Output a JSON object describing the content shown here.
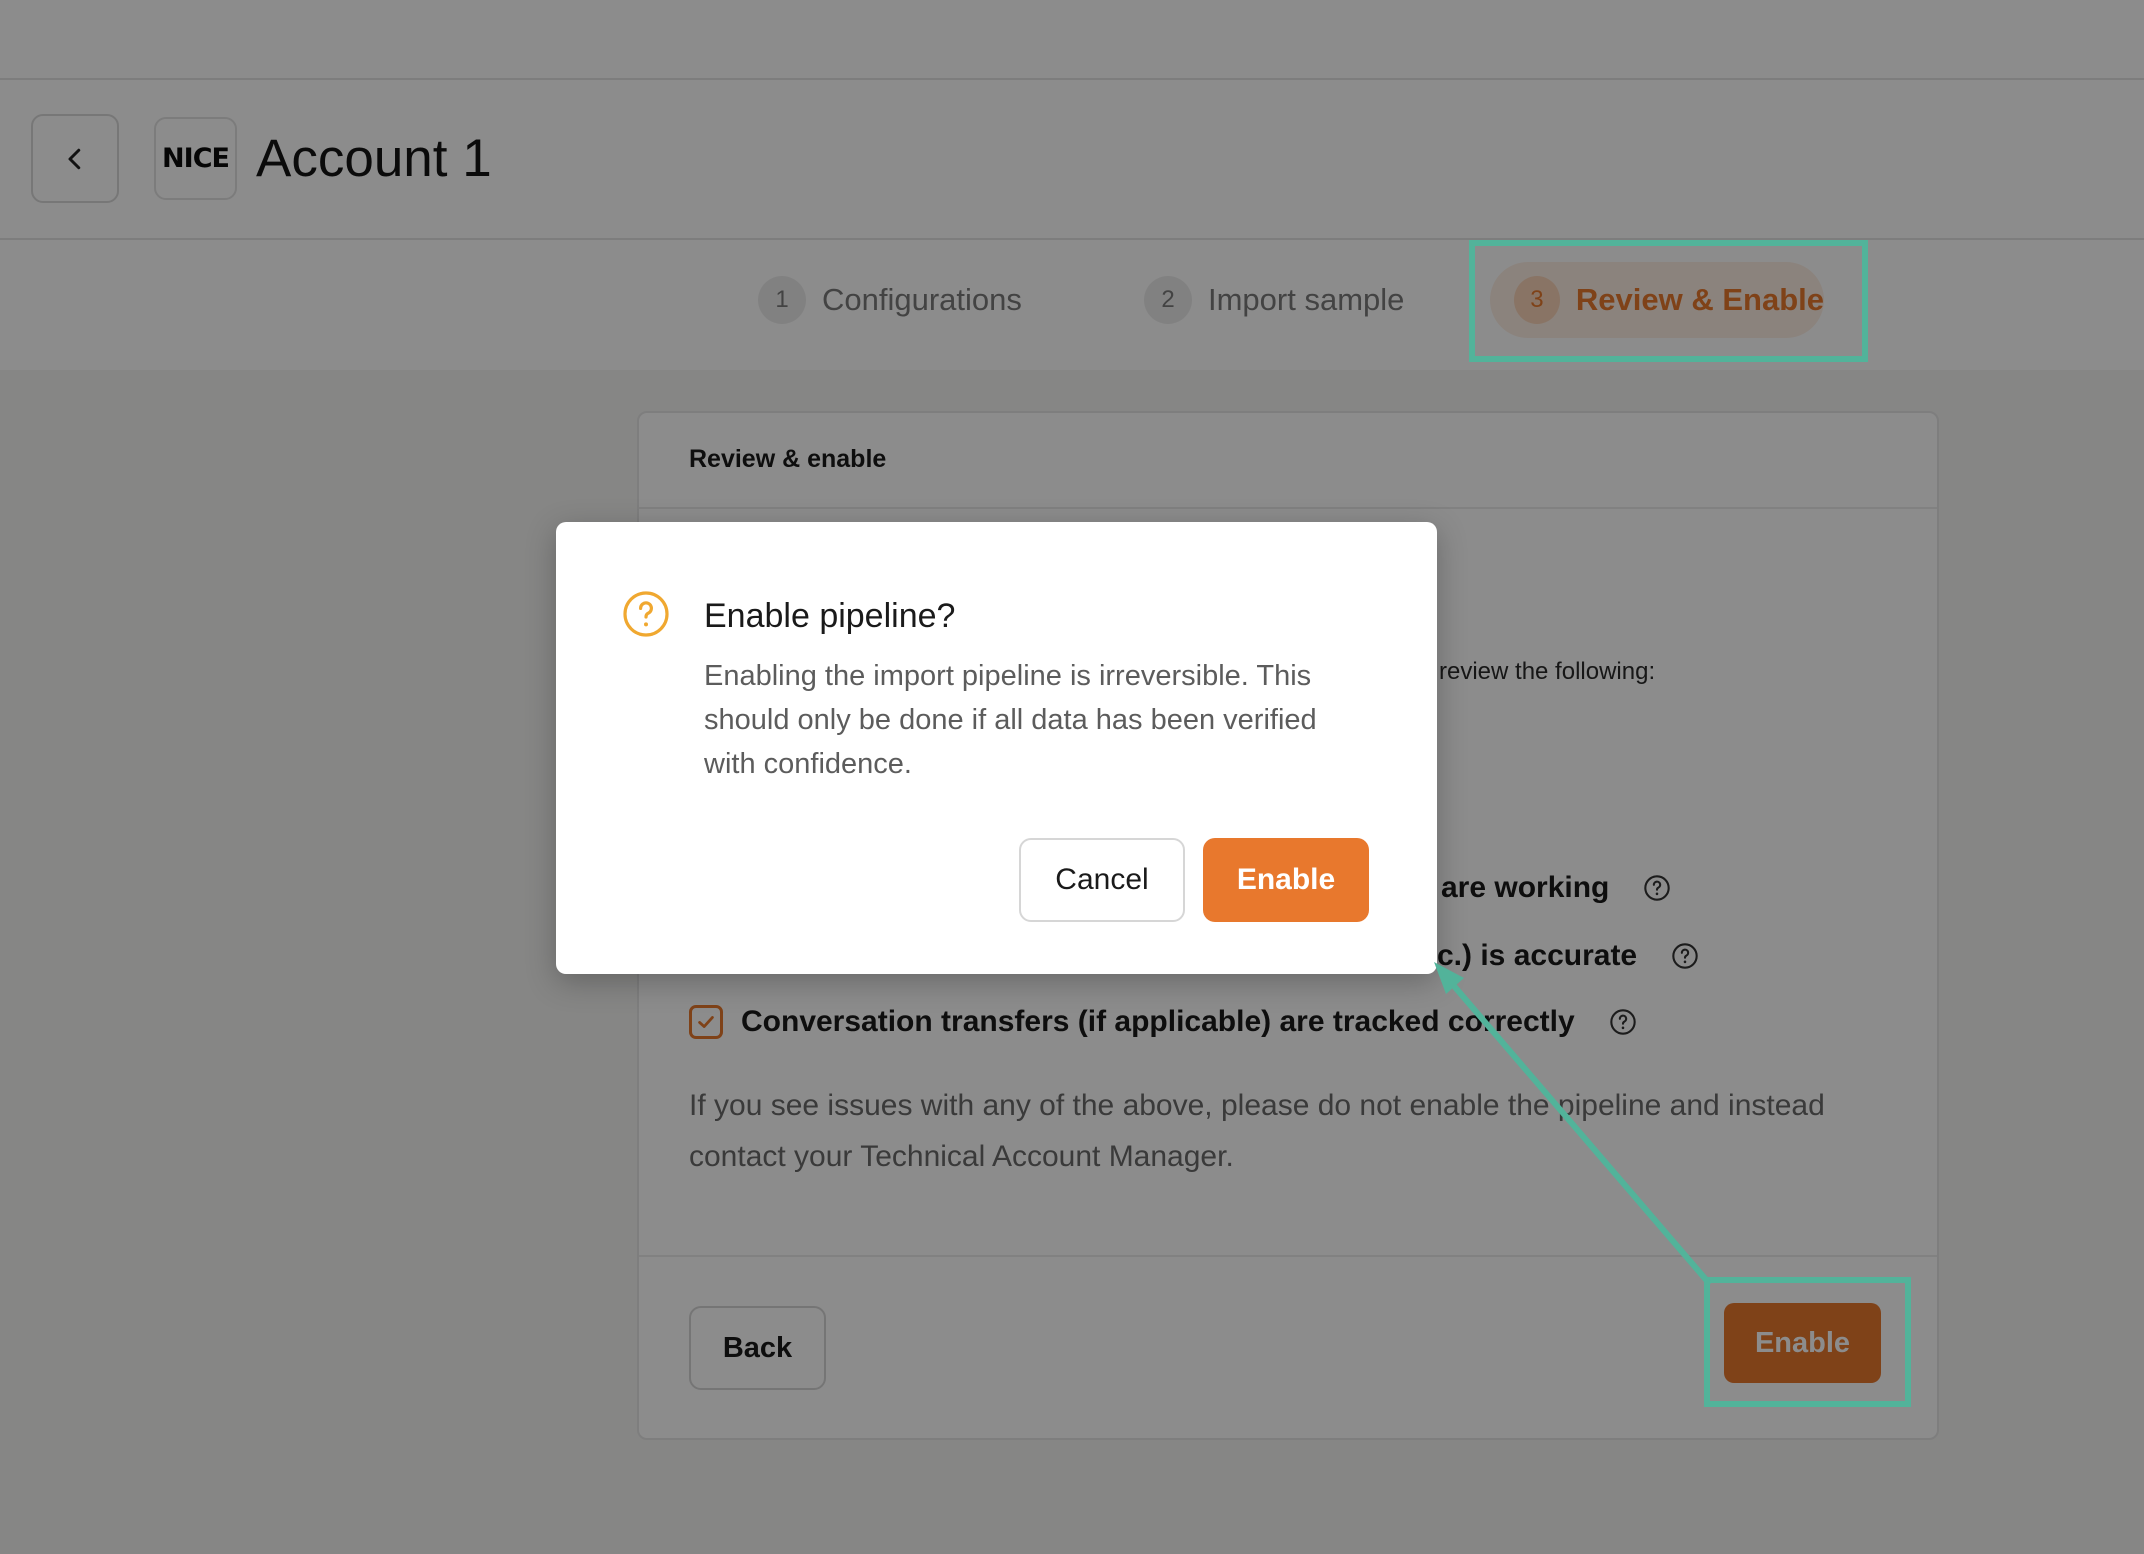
{
  "app": {
    "title": "Account 1",
    "logo_text": "NICE"
  },
  "stepper": {
    "steps": [
      {
        "number": "1",
        "label": "Configurations",
        "active": false
      },
      {
        "number": "2",
        "label": "Import sample",
        "active": false
      },
      {
        "number": "3",
        "label": "Review & Enable",
        "active": true
      }
    ]
  },
  "card": {
    "title": "Review & enable",
    "intro_visible_fragment": "review the following:",
    "checklist": [
      {
        "label": "are working",
        "checked": true
      },
      {
        "label": "c.) is accurate",
        "checked": true
      },
      {
        "label": "Conversation transfers (if applicable) are tracked correctly",
        "checked": true
      }
    ],
    "note": "If you see issues with any of the above, please do not enable the pipeline and instead contact your Technical Account Manager.",
    "back_label": "Back",
    "enable_label": "Enable"
  },
  "modal": {
    "title": "Enable pipeline?",
    "body": "Enabling the import pipeline is irreversible. This should only be done if all data has been verified with confidence.",
    "cancel_label": "Cancel",
    "enable_label": "Enable"
  },
  "colors": {
    "accent": "#e8782d",
    "annotation": "#52b39a",
    "warning_icon": "#f0a830"
  },
  "icons": {
    "back": "chevron-left-icon",
    "help": "question-circle-icon",
    "checkbox": "check-icon",
    "modal": "question-circle-icon"
  }
}
